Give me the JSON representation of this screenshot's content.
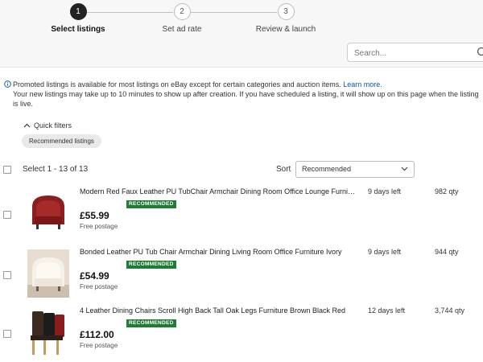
{
  "stepper": {
    "steps": [
      {
        "number": "1",
        "label": "Select listings",
        "active": true
      },
      {
        "number": "2",
        "label": "Set ad rate",
        "active": false
      },
      {
        "number": "3",
        "label": "Review & launch",
        "active": false
      }
    ]
  },
  "search": {
    "placeholder": "Search...",
    "icon": "search-icon"
  },
  "notice": {
    "icon": "info-icon",
    "line1": "Promoted listings is available for most listings on eBay except for certain categories and auction items.",
    "link": "Learn more.",
    "line2": "Your new listings may take up to 10 minutes to show up after creation. If you have scheduled a listing, it will show up on this page when the listing is live."
  },
  "filters": {
    "toggle_label": "Quick filters",
    "chip_label": "Recommended listings"
  },
  "list_header": {
    "select_count": "Select 1 - 13 of 13",
    "sort_label": "Sort",
    "sort_value": "Recommended"
  },
  "listings": [
    {
      "title": "Modern Red Faux Leather PU TubChair Armchair Dining Room Office Lounge Furniture",
      "badge": "RECOMMENDED",
      "price": "£55.99",
      "postage": "Free postage",
      "days_left": "9 days left",
      "qty": "982 qty"
    },
    {
      "title": "Bonded Leather PU Tub Chair Armchair Dining Living Room Office Furniture Ivory",
      "badge": "RECOMMENDED",
      "price": "£54.99",
      "postage": "Free postage",
      "days_left": "9 days left",
      "qty": "944 qty"
    },
    {
      "title": "4 Leather Dining Chairs Scroll High Back Tall Oak Legs Furniture Brown Black Red",
      "badge": "RECOMMENDED",
      "price": "£112.00",
      "postage": "Free postage",
      "days_left": "12 days left",
      "qty": "3,744 qty"
    }
  ],
  "colors": {
    "badge": "#1e7d32",
    "link": "#0654ba",
    "active_step": "#222222"
  }
}
